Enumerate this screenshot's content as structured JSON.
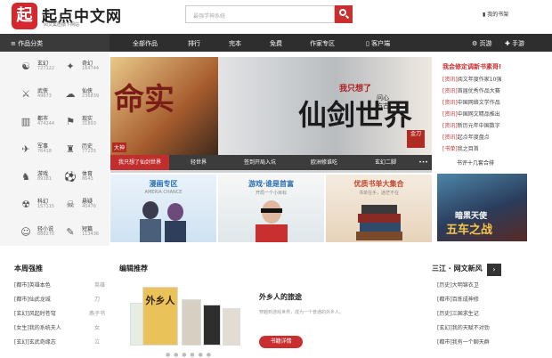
{
  "header": {
    "logo_glyph": "起",
    "logo_text": "起点中文网",
    "logo_sub": "阅文集团旗下网站",
    "search_placeholder": "最强学神系统",
    "reading_label": "我的书架"
  },
  "nav": {
    "category": "作品分类",
    "items": [
      "全部作品",
      "排行",
      "完本",
      "免费",
      "作家专区",
      "客户端",
      "页游",
      "手游"
    ]
  },
  "sidebar": [
    {
      "name": "玄幻",
      "count": "727122",
      "icon": "☯"
    },
    {
      "name": "奇幻",
      "count": "164744",
      "icon": "✦"
    },
    {
      "name": "武侠",
      "count": "49673",
      "icon": "⚔"
    },
    {
      "name": "仙侠",
      "count": "236839",
      "icon": "☁"
    },
    {
      "name": "都市",
      "count": "474244",
      "icon": "▥"
    },
    {
      "name": "现实",
      "count": "31893",
      "icon": "⚑"
    },
    {
      "name": "军事",
      "count": "76418",
      "icon": "✈"
    },
    {
      "name": "历史",
      "count": "77235",
      "icon": "♜"
    },
    {
      "name": "游戏",
      "count": "89381",
      "icon": "♞"
    },
    {
      "name": "体育",
      "count": "8643",
      "icon": "⚽"
    },
    {
      "name": "科幻",
      "count": "157115",
      "icon": "☢"
    },
    {
      "name": "悬疑",
      "count": "40476",
      "icon": "☠"
    },
    {
      "name": "轻小说",
      "count": "886270",
      "icon": "☺"
    },
    {
      "name": "短篇",
      "count": "113436",
      "icon": "✎"
    }
  ],
  "banner": {
    "title_left": "命实",
    "tag_left": "大神",
    "title_right": "仙剑世界",
    "subtitle_right": "我只想了",
    "vertical_text": "问心方古",
    "seal": "金刀",
    "tabs": [
      "我只想了仙剑世界",
      "轻世界",
      "签到开局入坑",
      "欧洲修谁吃",
      "玄幻二脚"
    ]
  },
  "cards": [
    {
      "title": "漫画专区",
      "sub": "AMERIA CHANCE"
    },
    {
      "title": "游戏·谁是首富",
      "sub": "开局一个小目标"
    },
    {
      "title": "优质书单大集合",
      "sub": "书单在手，迷茫不在"
    }
  ],
  "right_panel": {
    "heading": "我会修定调新书素哥!",
    "items": [
      {
        "tag": "[资讯]",
        "text": "阅文年度作家10强"
      },
      {
        "tag": "[资讯]",
        "text": "首届优秀作品大赛"
      },
      {
        "tag": "[资讯]",
        "text": "中国网络文学作品"
      },
      {
        "tag": "[资讯]",
        "text": "中国网文精品推出"
      },
      {
        "tag": "[资讯]",
        "text": "新历元年中国数字"
      },
      {
        "tag": "[资讯]",
        "text": "起点年度盘点"
      },
      {
        "tag": "[书单]",
        "text": "我之目首"
      }
    ],
    "footer": "书评十几套合排"
  },
  "promo": {
    "title": "五车之战",
    "subtitle": "暗黑天使"
  },
  "sections": {
    "weekly": "本周强推",
    "editor": "编辑推荐",
    "news": "三江 · 网文新风"
  },
  "weekly_list": [
    {
      "tag": "[都市]",
      "text": "英雄本色",
      "extra": "英雄"
    },
    {
      "tag": "[都市]",
      "text": "仙武龙城",
      "extra": "刀"
    },
    {
      "tag": "[玄幻]",
      "text": "风起时苍穹",
      "extra": "燕子书"
    },
    {
      "tag": "[女生]",
      "text": "我的系统夫人",
      "extra": "女"
    },
    {
      "tag": "[玄幻]",
      "text": "玄武奇缘志",
      "extra": "泣"
    }
  ],
  "editor": {
    "book_title": "外乡人的旅途",
    "desc": "穿越到游戏世界，成为一个普通的外乡人。",
    "button": "书籍详情",
    "cover_text": "外乡人"
  },
  "news_list": [
    {
      "tag": "[历史]",
      "text": "大明锦衣卫"
    },
    {
      "tag": "[都市]",
      "text": "百炼成神修"
    },
    {
      "tag": "[历史]",
      "text": "三国求生记"
    },
    {
      "tag": "[玄幻]",
      "text": "我的天赋不对劲"
    },
    {
      "tag": "[都市]",
      "text": "我有一个聊天群"
    }
  ],
  "colors": {
    "brand": "#c92f2f",
    "nav": "#2e2e2e"
  }
}
